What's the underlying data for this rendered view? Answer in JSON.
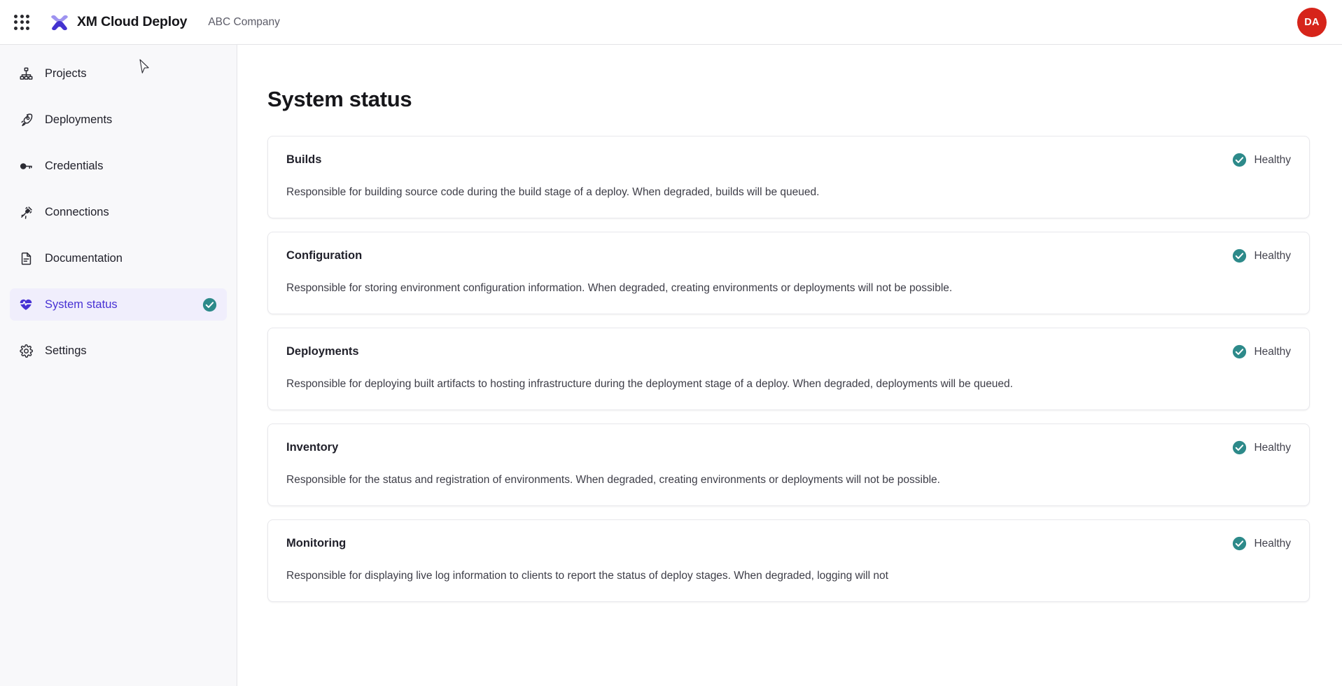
{
  "header": {
    "app_switcher_icon": "grid-apps-icon",
    "logo_icon": "xm-cloud-logo",
    "product_name": "XM Cloud Deploy",
    "organization": "ABC Company",
    "avatar_initials": "DA",
    "avatar_color": "#d6241a"
  },
  "sidebar": {
    "items": [
      {
        "label": "Projects",
        "icon": "sitemap-icon",
        "active": false
      },
      {
        "label": "Deployments",
        "icon": "rocket-icon",
        "active": false
      },
      {
        "label": "Credentials",
        "icon": "key-icon",
        "active": false
      },
      {
        "label": "Connections",
        "icon": "plug-connect-icon",
        "active": false
      },
      {
        "label": "Documentation",
        "icon": "document-icon",
        "active": false
      },
      {
        "label": "System status",
        "icon": "heart-pulse-icon",
        "active": true,
        "trailing_icon": "check-circle-icon"
      },
      {
        "label": "Settings",
        "icon": "gear-icon",
        "active": false
      }
    ],
    "active_text_color": "#4731d4",
    "active_bg_color": "#f0eefc"
  },
  "main": {
    "page_title": "System status",
    "status_ok_color": "#2d8a8a",
    "cards": [
      {
        "title": "Builds",
        "status": "Healthy",
        "status_icon": "check-circle-icon",
        "description": "Responsible for building source code during the build stage of a deploy. When degraded, builds will be queued."
      },
      {
        "title": "Configuration",
        "status": "Healthy",
        "status_icon": "check-circle-icon",
        "description": "Responsible for storing environment configuration information. When degraded, creating environments or deployments will not be possible."
      },
      {
        "title": "Deployments",
        "status": "Healthy",
        "status_icon": "check-circle-icon",
        "description": "Responsible for deploying built artifacts to hosting infrastructure during the deployment stage of a deploy. When degraded, deployments will be queued."
      },
      {
        "title": "Inventory",
        "status": "Healthy",
        "status_icon": "check-circle-icon",
        "description": "Responsible for the status and registration of environments. When degraded, creating environments or deployments will not be possible."
      },
      {
        "title": "Monitoring",
        "status": "Healthy",
        "status_icon": "check-circle-icon",
        "description": "Responsible for displaying live log information to clients to report the status of deploy stages. When degraded, logging will not"
      }
    ]
  }
}
